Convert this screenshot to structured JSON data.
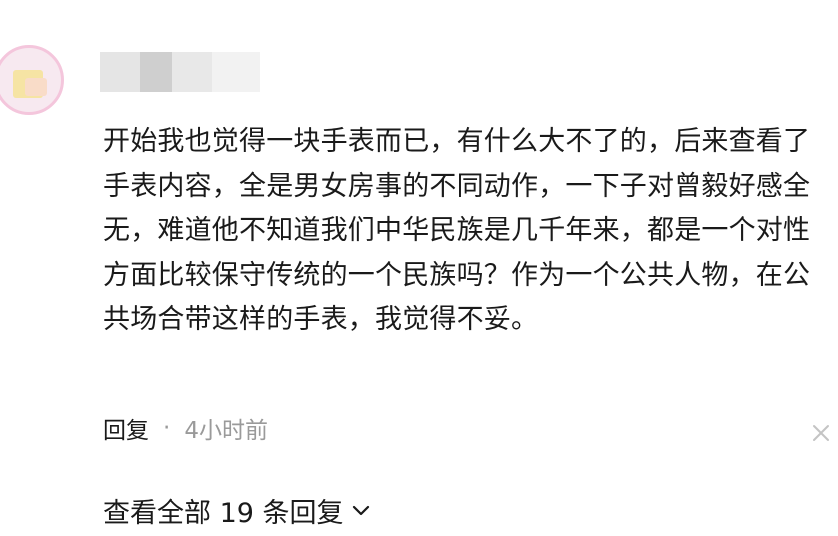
{
  "comment": {
    "avatar_icon": "user-avatar",
    "text": "开始我也觉得一块手表而已，有什么大不了的，后来查看了手表内容，全是男女房事的不同动作，一下子对曾毅好感全无，难道他不知道我们中华民族是几千年来，都是一个对性方面比较保守传统的一个民族吗？作为一个公共人物，在公共场合带这样的手表，我觉得不妥。",
    "reply_label": "回复",
    "separator": "·",
    "timestamp": "4小时前",
    "close_icon": "close-icon"
  },
  "replies": {
    "view_all_label": "查看全部 19 条回复",
    "chevron_icon": "chevron-down-icon"
  },
  "colors": {
    "text": "#1a1a1a",
    "muted": "#9a9a9a",
    "avatar_ring": "#f4c6dc"
  }
}
